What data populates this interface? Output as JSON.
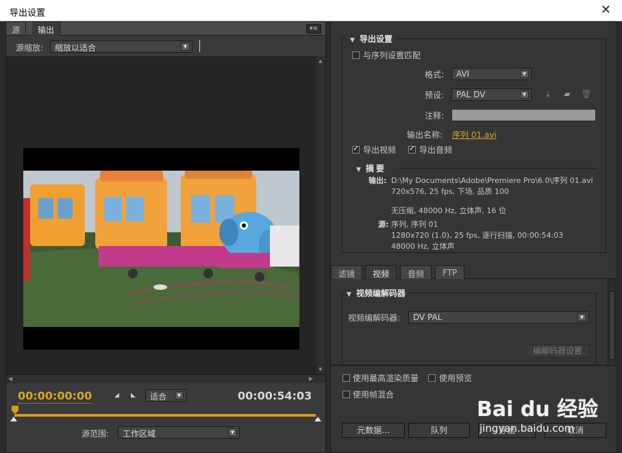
{
  "window": {
    "title": "导出设置",
    "close_glyph": "✕"
  },
  "left": {
    "tabs": [
      "源",
      "输出"
    ],
    "panel_menu_glyph": "▾≡",
    "source_scale_label": "源缩放:",
    "source_scale_value": "缩放以适合",
    "timecode_in": "00:00:00:00",
    "timecode_out": "00:00:54:03",
    "fit_value": "适合",
    "range_label": "源范围:",
    "range_value": "工作区域"
  },
  "export_settings": {
    "heading": "导出设置",
    "match_sequence": "与序列设置匹配",
    "format_label": "格式:",
    "format_value": "AVI",
    "preset_label": "预设:",
    "preset_value": "PAL DV",
    "comment_label": "注释:",
    "output_name_label": "输出名称:",
    "output_name_value": "序列 01.avi",
    "export_video": "导出视频",
    "export_audio": "导出音频",
    "summary_heading": "摘要",
    "output_label": "输出:",
    "output_line1": "D:\\My Documents\\Adobe\\Premiere Pro\\6.0\\序列 01.avi",
    "output_line2": "720x576, 25 fps, 下场, 品质 100",
    "output_line3": "无压缩, 48000 Hz, 立体声, 16 位",
    "source_label": "源:",
    "source_line1": "序列, 序列 01",
    "source_line2": "1280x720 (1.0), 25 fps, 逐行扫描, 00:00:54:03",
    "source_line3": "48000 Hz, 立体声"
  },
  "right_tabs": [
    "滤镜",
    "视频",
    "音频",
    "FTP"
  ],
  "video_codec": {
    "heading": "视频编解码器",
    "codec_label": "视频编解码器:",
    "codec_value": "DV PAL",
    "codec_settings_button": "编解码器设置"
  },
  "options": {
    "max_render_quality": "使用最高渲染质量",
    "use_previews": "使用预览",
    "frame_blending": "使用帧混合"
  },
  "buttons": {
    "metadata": "元数据...",
    "queue": "队列",
    "export": "导出",
    "cancel": "取消"
  },
  "watermark": {
    "logo": "Bai du 经验",
    "url": "jingyan.baidu.com"
  }
}
